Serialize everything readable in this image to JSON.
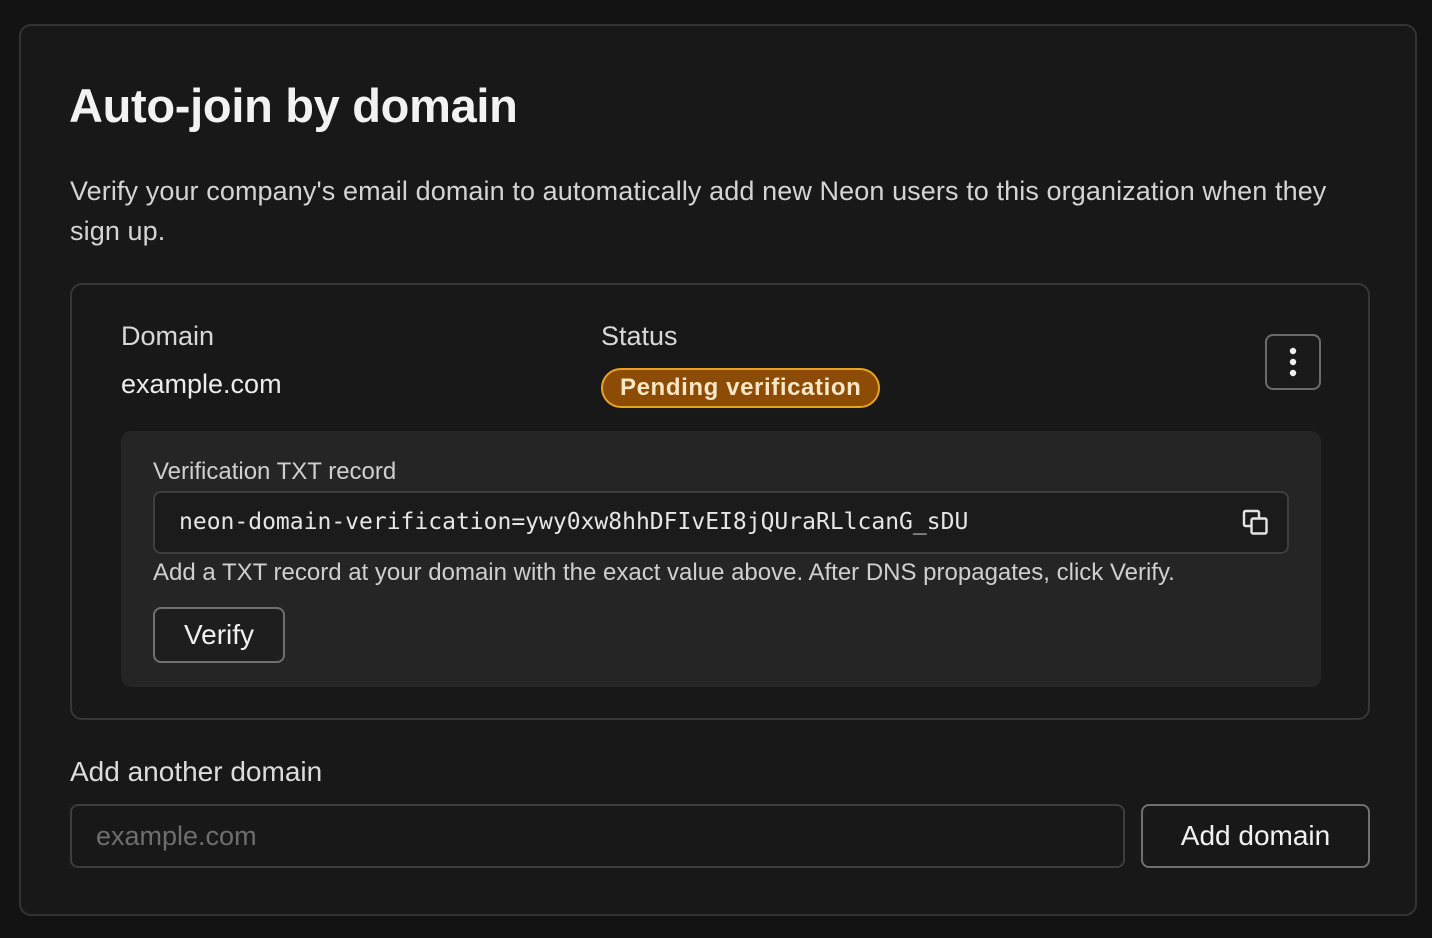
{
  "section": {
    "title": "Auto-join by domain",
    "description": "Verify your company's email domain to automatically add new Neon users to this organization when they sign up."
  },
  "domain_entry": {
    "domain_label": "Domain",
    "domain_value": "example.com",
    "status_label": "Status",
    "status_value": "Pending verification",
    "status_color": "#8c4c05",
    "more_icon": "vertical-dots-icon",
    "verification": {
      "label": "Verification TXT record",
      "record_value": "neon-domain-verification=ywy0xw8hhDFIvEI8jQUraRLlcanG_sDU",
      "copy_icon": "copy-icon",
      "hint": "Add a TXT record at your domain with the exact value above. After DNS propagates, click Verify.",
      "verify_label": "Verify"
    }
  },
  "add_domain": {
    "label": "Add another domain",
    "placeholder": "example.com",
    "button_label": "Add domain"
  }
}
